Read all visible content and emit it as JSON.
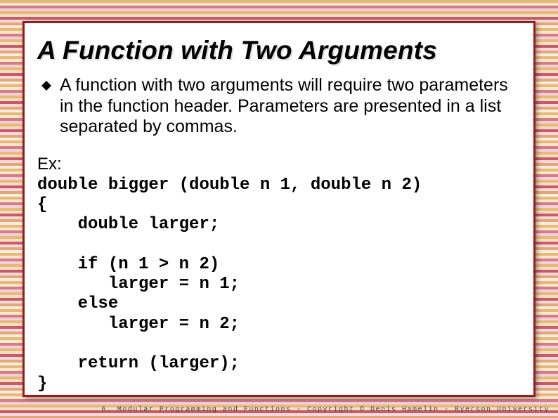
{
  "slide": {
    "title": "A Function with Two Arguments",
    "bullet_text": "A function with two arguments will require two parameters in the function header. Parameters are presented in a list separated by commas.",
    "bullet_icon": "diamond-bullet-icon",
    "example_label": "Ex:",
    "code": "double bigger (double n 1, double n 2)\n{\n    double larger;\n\n    if (n 1 > n 2)\n       larger = n 1;\n    else\n       larger = n 2;\n\n    return (larger);\n}"
  },
  "footer": "6. Modular Programming and Functions - Copyright © Denis Hamelin - Ryerson University"
}
